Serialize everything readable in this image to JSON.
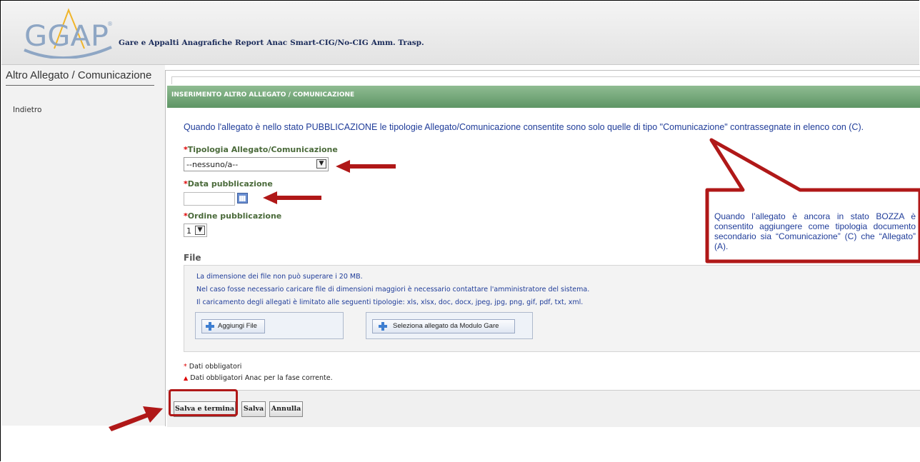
{
  "app": {
    "logo_text": "GGAP"
  },
  "nav": {
    "items": [
      "Gare e Appalti",
      "Anagrafiche",
      "Report",
      "Anac",
      "Smart-CIG/No-CIG",
      "Amm. Trasp."
    ]
  },
  "sidebar": {
    "title": "Altro Allegato / Comunicazione",
    "back_link": "Indietro"
  },
  "section": {
    "title": "INSERIMENTO ALTRO ALLEGATO / COMUNICAZIONE",
    "notice": "Quando l'allegato è nello stato PUBBLICAZIONE le tipologie Allegato/Comunicazione consentite sono solo quelle di tipo \"Comunicazione\" contrassegnate in elenco con (C)."
  },
  "form": {
    "required_mark": "*",
    "tipologia_label": "Tipologia Allegato/Comunicazione",
    "tipologia_value": "--nessuno/a--",
    "data_label": "Data pubblicazione",
    "data_value": "",
    "ordine_label": "Ordine pubblicazione",
    "ordine_value": "1"
  },
  "file": {
    "title": "File",
    "line1": "La dimensione dei file non può superare i 20 MB.",
    "line2": "Nel caso fosse necessario caricare file di dimensioni maggiori è necessario contattare l'amministratore del sistema.",
    "line3": "Il caricamento degli allegati è limitato alle seguenti tipologie: xls, xlsx, doc, docx, jpeg, jpg, png, gif, pdf, txt, xml.",
    "add_button": "Aggiungi File",
    "select_button": "Seleziona allegato da Modulo Gare"
  },
  "legend": {
    "required": "Dati obbligatori",
    "anac": "Dati obbligatori Anac per la fase corrente."
  },
  "footer": {
    "save_close": "Salva e termina",
    "save": "Salva",
    "cancel": "Annulla"
  },
  "callout": {
    "text": "Quando l’allegato è ancora in stato BOZZA è consentito aggiungere come tipologia documento secondario sia “Comunicazione” (C) che “Allegato” (A)."
  },
  "colors": {
    "green_header": "#6f9f74",
    "link_blue": "#1f3c99",
    "annotation_red": "#b01818"
  }
}
